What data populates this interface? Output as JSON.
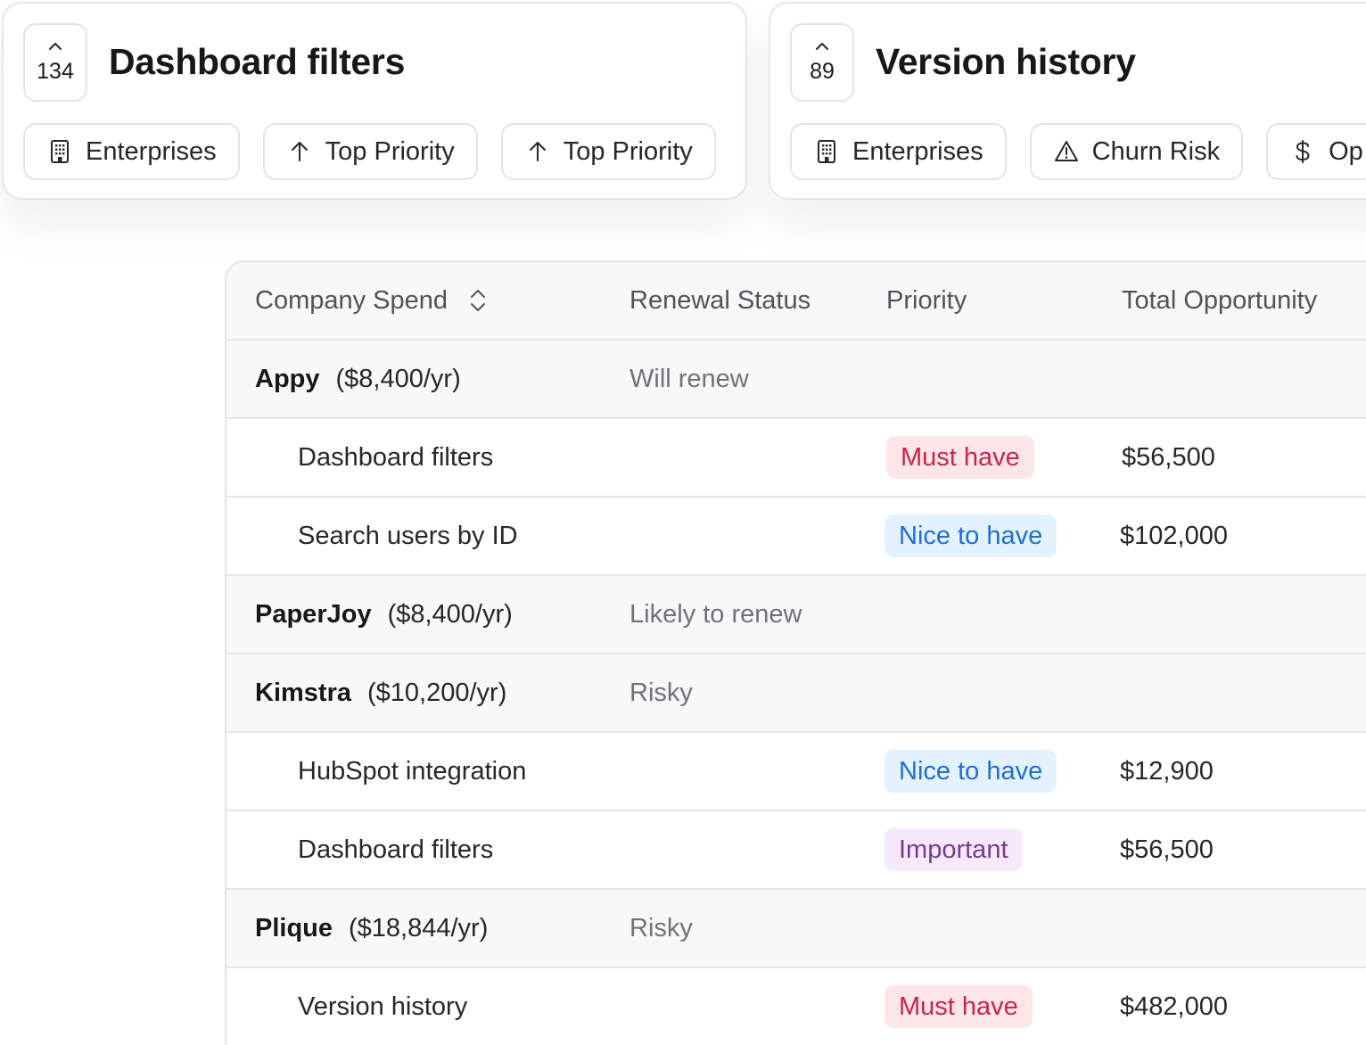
{
  "cards": [
    {
      "votes": "134",
      "title": "Dashboard filters",
      "chips": [
        {
          "icon": "building-icon",
          "label": "Enterprises"
        },
        {
          "icon": "arrow-up-icon",
          "label": "Top Priority"
        },
        {
          "icon": "arrow-up-icon",
          "label": "Top Priority"
        }
      ]
    },
    {
      "votes": "89",
      "title": "Version history",
      "chips": [
        {
          "icon": "building-icon",
          "label": "Enterprises"
        },
        {
          "icon": "warning-icon",
          "label": "Churn Risk"
        },
        {
          "icon": "dollar-icon",
          "label": "Op"
        }
      ]
    }
  ],
  "table": {
    "columns": {
      "company": "Company Spend",
      "renewal": "Renewal Status",
      "priority": "Priority",
      "opportunity": "Total Opportunity"
    },
    "rows": [
      {
        "type": "company",
        "name": "Appy",
        "spend": "($8,400/yr)",
        "status": "Will renew"
      },
      {
        "type": "feature",
        "feature": "Dashboard filters",
        "priority": "Must have",
        "priority_kind": "must",
        "amount": "$56,500"
      },
      {
        "type": "feature",
        "feature": "Search users by ID",
        "priority": "Nice to have",
        "priority_kind": "nice",
        "amount": "$102,000"
      },
      {
        "type": "company",
        "name": "PaperJoy",
        "spend": "($8,400/yr)",
        "status": "Likely to renew"
      },
      {
        "type": "company",
        "name": "Kimstra",
        "spend": "($10,200/yr)",
        "status": "Risky"
      },
      {
        "type": "feature",
        "feature": "HubSpot integration",
        "priority": "Nice to have",
        "priority_kind": "nice",
        "amount": "$12,900"
      },
      {
        "type": "feature",
        "feature": "Dashboard filters",
        "priority": "Important",
        "priority_kind": "important",
        "amount": "$56,500"
      },
      {
        "type": "company",
        "name": "Plique",
        "spend": "($18,844/yr)",
        "status": "Risky"
      },
      {
        "type": "feature",
        "feature": "Version history",
        "priority": "Must have",
        "priority_kind": "must",
        "amount": "$482,000"
      }
    ]
  }
}
